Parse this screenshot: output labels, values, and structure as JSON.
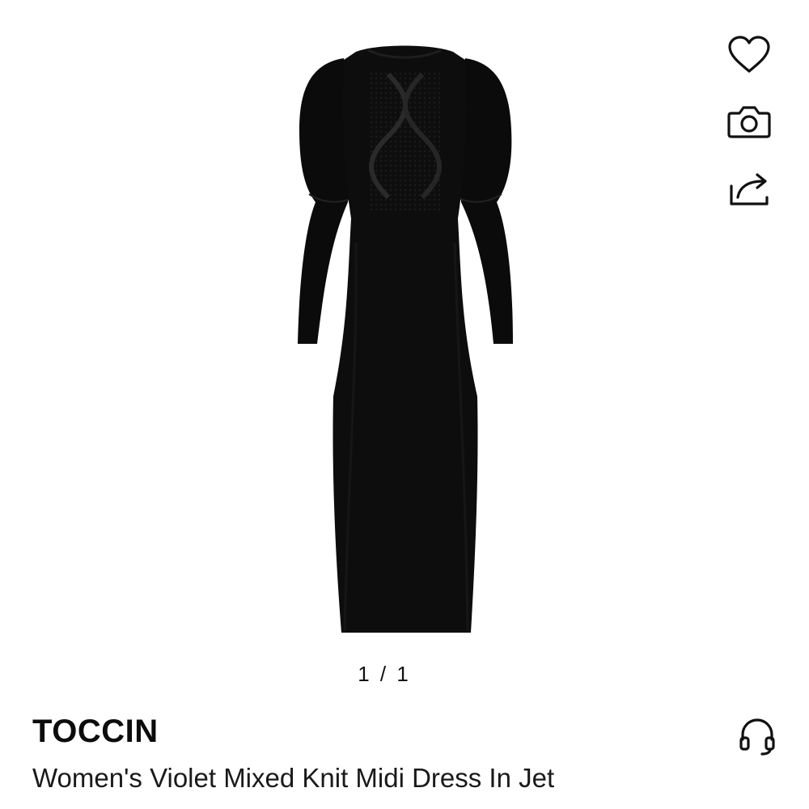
{
  "product": {
    "brand": "TOCCIN",
    "name": "Women's Violet Mixed Knit Midi Dress In Jet",
    "image_alt": "Black knit midi dress with puff sleeves and cable-knit bib front"
  },
  "gallery": {
    "pager": "1 / 1"
  },
  "actions": [
    {
      "icon": "heart-icon",
      "label": "Add to wishlist"
    },
    {
      "icon": "camera-icon",
      "label": "Visual search"
    },
    {
      "icon": "share-icon",
      "label": "Share"
    }
  ],
  "support": {
    "icon": "headset-icon"
  },
  "colors": {
    "text": "#111111",
    "dress": "#0d0d0d",
    "background": "#ffffff"
  }
}
